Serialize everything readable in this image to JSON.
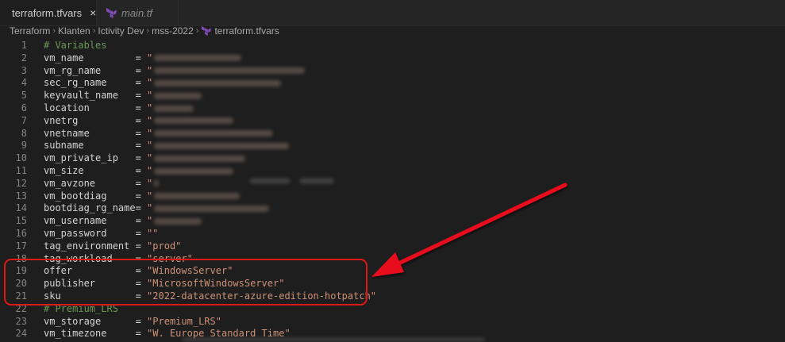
{
  "tabs": [
    {
      "label": "terraform.tfvars",
      "active": true,
      "icon": "terraform-icon",
      "close": "×"
    },
    {
      "label": "main.tf",
      "active": false,
      "icon": "terraform-icon"
    }
  ],
  "breadcrumb": [
    "Terraform",
    "Klanten",
    "Ictivity Dev",
    "mss-2022",
    "terraform.tfvars"
  ],
  "breadcrumb_separator": "›",
  "colors": {
    "terraform_icon": "#844fba",
    "highlight_box": "#e01818",
    "arrow": "#e8111b",
    "string": "#ce9178",
    "comment": "#6a9955"
  },
  "editor": {
    "lines": [
      {
        "num": "1",
        "key": "# Variables",
        "type": "comment"
      },
      {
        "num": "2",
        "key": "vm_name         = ",
        "value": "\"",
        "redacted": true
      },
      {
        "num": "3",
        "key": "vm_rg_name      = ",
        "value": "\"",
        "redacted": true
      },
      {
        "num": "4",
        "key": "sec_rg_name     = ",
        "value": "\"",
        "redacted": true
      },
      {
        "num": "5",
        "key": "keyvault_name   = ",
        "value": "\"",
        "redacted": true
      },
      {
        "num": "6",
        "key": "location        = ",
        "value": "\"",
        "redacted": true
      },
      {
        "num": "7",
        "key": "vnetrg          = ",
        "value": "\"",
        "redacted": true
      },
      {
        "num": "8",
        "key": "vnetname        = ",
        "value": "\"",
        "redacted": true
      },
      {
        "num": "9",
        "key": "subname         = ",
        "value": "\"",
        "redacted": true
      },
      {
        "num": "10",
        "key": "vm_private_ip   = ",
        "value": "\"",
        "redacted": true
      },
      {
        "num": "11",
        "key": "vm_size         = ",
        "value": "\"",
        "redacted": true
      },
      {
        "num": "12",
        "key": "vm_avzone       = ",
        "value": "\"",
        "redacted": true
      },
      {
        "num": "13",
        "key": "vm_bootdiag     = ",
        "value": "\"",
        "redacted": true
      },
      {
        "num": "14",
        "key": "bootdiag_rg_name= ",
        "value": "\"",
        "redacted": true
      },
      {
        "num": "15",
        "key": "vm_username     = ",
        "value": "\"",
        "redacted": true
      },
      {
        "num": "16",
        "key": "vm_password     = ",
        "value": "\"\""
      },
      {
        "num": "17",
        "key": "tag_environment = ",
        "value": "\"prod\""
      },
      {
        "num": "18",
        "key": "tag_workload    = ",
        "value": "\"server\""
      },
      {
        "num": "19",
        "key": "offer           = ",
        "value": "\"WindowsServer\""
      },
      {
        "num": "20",
        "key": "publisher       = ",
        "value": "\"MicrosoftWindowsServer\""
      },
      {
        "num": "21",
        "key": "sku             = ",
        "value": "\"2022-datacenter-azure-edition-hotpatch\""
      },
      {
        "num": "22",
        "key": "# Premium_LRS",
        "type": "comment"
      },
      {
        "num": "23",
        "key": "vm_storage      = ",
        "value": "\"Premium_LRS\""
      },
      {
        "num": "24",
        "key": "vm_timezone     = ",
        "value": "\"W. Europe Standard Time\""
      }
    ]
  }
}
